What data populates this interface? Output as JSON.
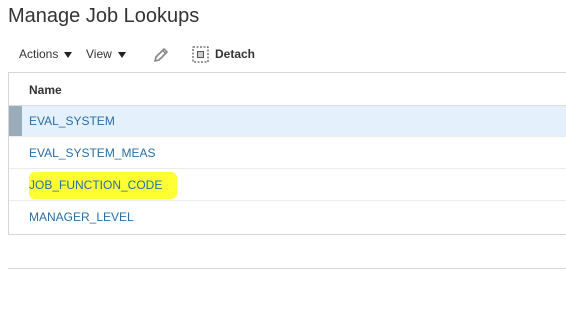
{
  "page": {
    "title": "Manage Job Lookups"
  },
  "toolbar": {
    "actions_label": "Actions",
    "view_label": "View",
    "edit_icon": "pencil-icon",
    "detach_icon": "detach-icon",
    "detach_label": "Detach"
  },
  "table": {
    "column_header": "Name",
    "rows": [
      {
        "name": "EVAL_SYSTEM",
        "selected": true,
        "highlighted": false
      },
      {
        "name": "EVAL_SYSTEM_MEAS",
        "selected": false,
        "highlighted": false
      },
      {
        "name": "JOB_FUNCTION_CODE",
        "selected": false,
        "highlighted": true
      },
      {
        "name": "MANAGER_LEVEL",
        "selected": false,
        "highlighted": false
      }
    ]
  },
  "colors": {
    "link": "#2a6ea5",
    "selected_row": "#e4f0fb",
    "selection_indicator": "#9aabba",
    "highlight": "#ffff33"
  }
}
